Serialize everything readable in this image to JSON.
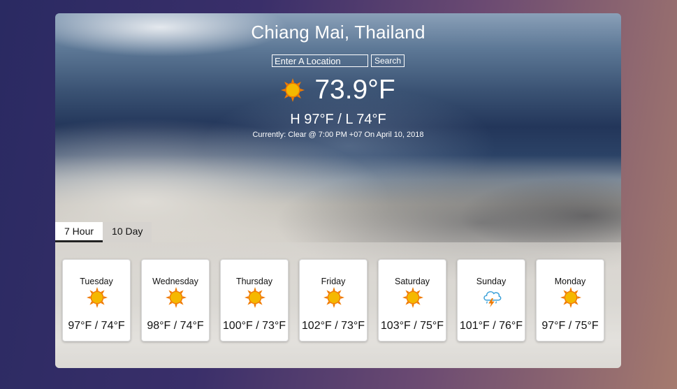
{
  "location": "Chiang Mai, Thailand",
  "search": {
    "placeholder": "Enter A Location",
    "button_label": "Search"
  },
  "current": {
    "icon": "sun-icon",
    "temperature": "73.9°F",
    "high_low": "H 97°F / L 74°F",
    "summary": "Currently: Clear @ 7:00 PM +07 On April 10, 2018"
  },
  "tabs": [
    {
      "label": "7 Hour",
      "active": true
    },
    {
      "label": "10 Day",
      "active": false
    }
  ],
  "days": [
    {
      "name": "Tuesday",
      "icon": "sun-icon",
      "temp": "97°F / 74°F"
    },
    {
      "name": "Wednesday",
      "icon": "sun-icon",
      "temp": "98°F / 74°F"
    },
    {
      "name": "Thursday",
      "icon": "sun-icon",
      "temp": "100°F / 73°F"
    },
    {
      "name": "Friday",
      "icon": "sun-icon",
      "temp": "102°F / 73°F"
    },
    {
      "name": "Saturday",
      "icon": "sun-icon",
      "temp": "103°F / 75°F"
    },
    {
      "name": "Sunday",
      "icon": "thunderstorm-icon",
      "temp": "101°F / 76°F"
    },
    {
      "name": "Monday",
      "icon": "sun-icon",
      "temp": "97°F / 75°F"
    }
  ],
  "colors": {
    "sun_core": "#f5b800",
    "sun_rays": "#f07a00",
    "text_light": "#ffffff",
    "text_dark": "#111111"
  }
}
